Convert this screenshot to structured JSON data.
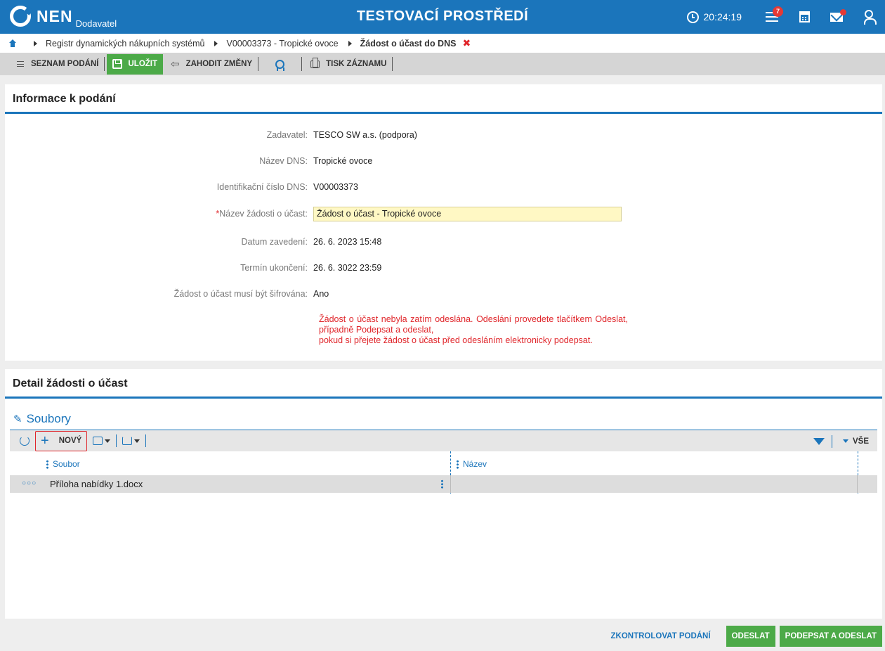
{
  "header": {
    "logo_text": "NEN",
    "logo_sub": "Dodavatel",
    "env_title": "TESTOVACÍ PROSTŘEDÍ",
    "clock": "20:24:19",
    "notif_count": "7"
  },
  "breadcrumb": {
    "items": [
      "Registr dynamických nákupních systémů",
      "V00003373 - Tropické ovoce"
    ],
    "current": "Žádost o účast do DNS",
    "close_glyph": "✖"
  },
  "toolbar": {
    "list_label": "SEZNAM PODÁNÍ",
    "save_label": "ULOŽIT",
    "discard_label": "ZAHODIT ZMĚNY",
    "print_label": "TISK ZÁZNAMU"
  },
  "info": {
    "title": "Informace k podání",
    "fields": [
      {
        "label": "Zadavatel:",
        "value": "TESCO SW a.s. (podpora)"
      },
      {
        "label": "Název DNS:",
        "value": "Tropické ovoce"
      },
      {
        "label": "Identifikační číslo DNS:",
        "value": "V00003373"
      },
      {
        "label": "Název žádosti o účast:",
        "value": "Žádost o účast - Tropické ovoce",
        "required": true
      },
      {
        "label": "Datum zavedení:",
        "value": "26. 6. 2023 15:48"
      },
      {
        "label": "Termín ukončení:",
        "value": "26. 6. 3022 23:59"
      },
      {
        "label": "Žádost o účast musí být šifrována:",
        "value": "Ano"
      }
    ],
    "warning": "Žádost o účast nebyla zatím odeslána. Odeslání provedete tlačítkem Odeslat, případně Podepsat a odeslat,",
    "warning2": "pokud si přejete žádost o účast před odesláním elektronicky podepsat."
  },
  "detail": {
    "title": "Detail žádosti o účast",
    "files_title": "Soubory",
    "new_label": "NOVÝ",
    "filter_all": "VŠE",
    "columns": [
      "Soubor",
      "Název"
    ],
    "rows": [
      {
        "file": "Příloha nabídky 1.docx",
        "name": ""
      }
    ]
  },
  "footer": {
    "check_label": "ZKONTROLOVAT PODÁNÍ",
    "send_label": "ODESLAT",
    "sign_send_label": "PODEPSAT A ODESLAT"
  },
  "colors": {
    "brand": "#1b75bb",
    "accent_green": "#4caa48",
    "warning": "#e0262b",
    "input_bg": "#fff8c4"
  }
}
